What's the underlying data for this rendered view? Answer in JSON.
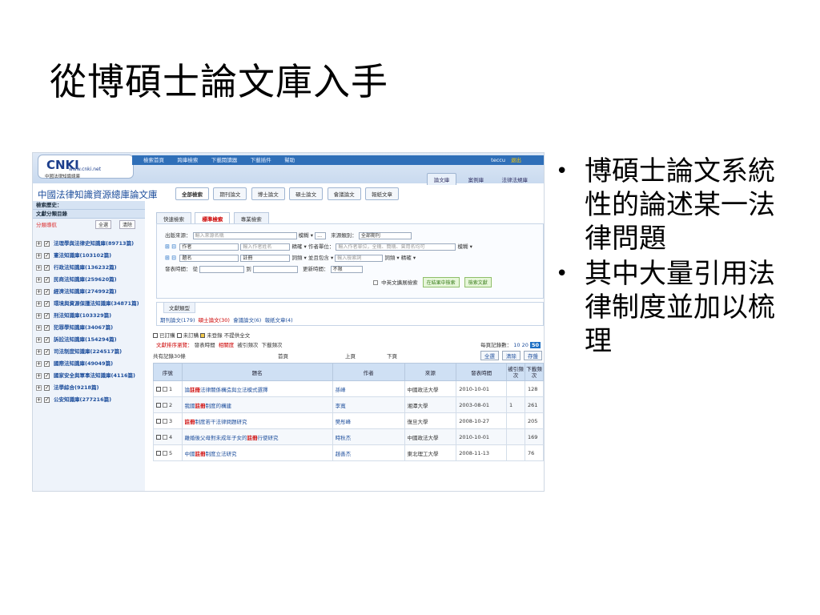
{
  "slide": {
    "title": "從博碩士論文庫入手",
    "bullets": [
      "博碩士論文系統性的論述某一法律問題",
      "其中大量引用法律制度並加以梳理"
    ]
  },
  "screenshot": {
    "logo": {
      "mark": "CNKI",
      "url": "www.cnki.net",
      "sub": "中國法律知識總庫"
    },
    "topnav": [
      "檢索首頁",
      "跨庫檢索",
      "下載閱讀器",
      "下載插件",
      "幫助"
    ],
    "user": "teccu",
    "logout": "退出",
    "db_tabs": [
      "論文庫",
      "案例庫",
      "法律法規庫"
    ],
    "lib_title": "中國法律知識資源總庫論文庫",
    "main_tabs": [
      "全部檢索",
      "期刊論文",
      "博士論文",
      "碩士論文",
      "會議論文",
      "報紙文章"
    ],
    "sidebar": {
      "history_label": "檢索歷史：",
      "nav_label": "文獻分類目錄",
      "class_label": "分類導航",
      "select_all": "全選",
      "clear": "清除",
      "items": [
        {
          "label": "法理學與法律史知識庫(89713篇)"
        },
        {
          "label": "憲法知識庫(103102篇)"
        },
        {
          "label": "行政法知識庫(136232篇)"
        },
        {
          "label": "民商法知識庫(259620篇)"
        },
        {
          "label": "經濟法知識庫(274992篇)"
        },
        {
          "label": "環境與資源保護法知識庫(34871篇)"
        },
        {
          "label": "刑法知識庫(103329篇)"
        },
        {
          "label": "犯罪學知識庫(34067篇)"
        },
        {
          "label": "訴訟法知識庫(154294篇)"
        },
        {
          "label": "司法制度知識庫(224517篇)"
        },
        {
          "label": "國際法知識庫(49049篇)"
        },
        {
          "label": "國家安全與軍事法知識庫(4116篇)"
        },
        {
          "label": "法學綜合(9218篇)"
        },
        {
          "label": "公安知識庫(277216篇)"
        }
      ]
    },
    "search_tabs": [
      "快速檢索",
      "標準檢索",
      "專業檢索"
    ],
    "form": {
      "source_label": "出版來源：",
      "source_placeholder": "輸入來源名稱",
      "exact": "模糊",
      "source_cat_label": "來源類別：",
      "source_cat_value": "全部期刊",
      "author_field": "作者",
      "author_placeholder": "輸入作者姓名",
      "exact2": "精確",
      "unit_label": "作者單位：",
      "unit_placeholder": "輸入作者單位，全稱、簡稱、曾用名均可",
      "exact3": "模糊",
      "title_field": "題名",
      "keyword_value": "註冊",
      "freq_label": "詞頻",
      "andor_label": "並且包含",
      "kw_placeholder": "輸入檢索詞",
      "freq_label2": "詞頻",
      "exact4": "精確",
      "date_label": "發表時間：",
      "from_label": "從",
      "to_label": "到",
      "update_label": "更新時間：",
      "update_value": "不限",
      "cross_lang": "中英文擴展檢索",
      "btn_in_result": "在結果中檢索",
      "btn_search": "檢索文獻"
    },
    "lit_type": {
      "tab": "文獻類型",
      "items": [
        "期刊論文(179)",
        "碩士論文(30)",
        "會議論文(6)",
        "報紙文章(4)"
      ]
    },
    "legend": [
      "已訂購",
      "未訂購",
      "未登錄 不提供全文"
    ],
    "sort": {
      "label": "文獻排序瀏覽：",
      "options": [
        "發表時間",
        "相關度",
        "被引頻次",
        "下載頻次"
      ],
      "per_page_label": "每頁記錄數：",
      "per_page": [
        "10",
        "20",
        "50"
      ]
    },
    "count": {
      "text": "共有記錄30條",
      "first": "首頁",
      "prev": "上頁",
      "next": "下頁",
      "btns": [
        "全選",
        "清除",
        "存盤"
      ]
    },
    "table": {
      "headers": [
        "序號",
        "題名",
        "作者",
        "來源",
        "發表時間",
        "被引頻次",
        "下載頻次"
      ],
      "rows": [
        {
          "seq": "1",
          "t_pre": "論",
          "t_hl": "註冊",
          "t_post": "法律關係構造與立法模式選擇",
          "author": "孫峰",
          "source": "中國政法大學",
          "date": "2010-10-01",
          "cited": "",
          "downloads": "128"
        },
        {
          "seq": "2",
          "t_pre": "我國",
          "t_hl": "註冊",
          "t_post": "制度的構建",
          "author": "李寬",
          "source": "湘潭大學",
          "date": "2003-08-01",
          "cited": "1",
          "downloads": "261"
        },
        {
          "seq": "3",
          "t_pre": "",
          "t_hl": "註冊",
          "t_post": "制度若干法律問題研究",
          "author": "樊彤峰",
          "source": "復旦大學",
          "date": "2008-10-27",
          "cited": "",
          "downloads": "205"
        },
        {
          "seq": "4",
          "t_pre": "離婚後父母對未成年子女的",
          "t_hl": "註冊",
          "t_post": "行使研究",
          "author": "時秋杰",
          "source": "中國政法大學",
          "date": "2010-10-01",
          "cited": "",
          "downloads": "169"
        },
        {
          "seq": "5",
          "t_pre": "中國",
          "t_hl": "註冊",
          "t_post": "制度立法研究",
          "author": "趙善杰",
          "source": "東北理工大學",
          "date": "2008-11-13",
          "cited": "",
          "downloads": "76"
        }
      ]
    }
  }
}
